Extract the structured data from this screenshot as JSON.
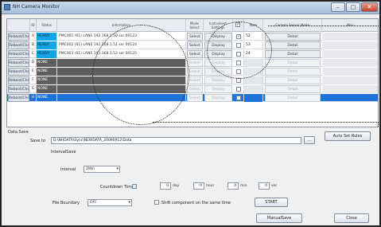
{
  "window": {
    "title": "NH Camera Monitor",
    "controls": {
      "minimize": "–",
      "maximize": "□",
      "close": "✕"
    }
  },
  "grid": {
    "columns": [
      {
        "key": "reset",
        "label": ""
      },
      {
        "key": "id",
        "label": "ID"
      },
      {
        "key": "status",
        "label": "Status"
      },
      {
        "key": "info",
        "label": "Information"
      },
      {
        "key": "mode",
        "label": "Mode\nSelect"
      },
      {
        "key": "params",
        "label": "Instrument\nSettings"
      },
      {
        "key": "check",
        "label": ""
      },
      {
        "key": "num",
        "label": "Num"
      },
      {
        "key": "sub",
        "label": "Camera Sensor Mode"
      },
      {
        "key": "misc",
        "label": "Misc"
      }
    ],
    "rows": [
      {
        "reset": "Reboot/Check",
        "id": "A",
        "status": "READY",
        "info": "PMC001 (01) LANE 192.168.1.50 ser 00123",
        "select": "Select",
        "display": "Display",
        "checked": true,
        "num": "52",
        "detail": "Detail",
        "enabled": true,
        "selected": false
      },
      {
        "reset": "Reboot/Check",
        "id": "B",
        "status": "READY",
        "info": "PMC002 (01) LANE 192.168.1.51 ser 00124",
        "select": "Select",
        "display": "Display",
        "checked": false,
        "num": "53",
        "detail": "Detail",
        "enabled": true,
        "selected": false
      },
      {
        "reset": "Reboot/Check",
        "id": "C",
        "status": "READY",
        "info": "PMC003 (01) LANE 192.168.1.52 ser 00125",
        "select": "Select",
        "display": "Display",
        "checked": false,
        "num": "24",
        "detail": "Detail",
        "enabled": true,
        "selected": false
      },
      {
        "reset": "Reboot/Check",
        "id": "D",
        "status": "NONE",
        "info": "",
        "select": "Select",
        "display": "Display",
        "checked": false,
        "num": "",
        "detail": "Detail",
        "enabled": false,
        "selected": false
      },
      {
        "reset": "Reboot/Check",
        "id": "E",
        "status": "NONE",
        "info": "",
        "select": "Select",
        "display": "Display",
        "checked": false,
        "num": "",
        "detail": "Detail",
        "enabled": false,
        "selected": false
      },
      {
        "reset": "Reboot/Check",
        "id": "F",
        "status": "NONE",
        "info": "",
        "select": "Select",
        "display": "Display",
        "checked": false,
        "num": "",
        "detail": "Detail",
        "enabled": false,
        "selected": false
      },
      {
        "reset": "Reboot/Check",
        "id": "G",
        "status": "NONE",
        "info": "",
        "select": "Select",
        "display": "Display",
        "checked": false,
        "num": "",
        "detail": "Detail",
        "enabled": false,
        "selected": false
      },
      {
        "reset": "Reboot/Check",
        "id": "H",
        "status": "NONE",
        "info": "",
        "select": "Select",
        "display": "Display",
        "checked": false,
        "num": "",
        "detail": "Detail",
        "enabled": false,
        "selected": true
      }
    ]
  },
  "data_save": {
    "section_label": "Data Save",
    "save_to_label": "Save to",
    "save_to_value": "D:\\NHDATA\\Sync\\NEWDATA_20090912\\Data",
    "browse_label": "...",
    "auto_set_label": "Auto Set Rules",
    "interval_save_label": "IntervalSave",
    "interval_label": "Interval",
    "interval_value": "1Min",
    "countdown_label": "Countdown Timer",
    "days_value": "0",
    "days_unit": "day",
    "hours_value": "0",
    "hours_unit": "hour",
    "mins_value": "0",
    "mins_unit": "min",
    "secs_value": "0",
    "secs_unit": "sec",
    "file_boundary_label": "File Boundary",
    "file_boundary_value": "OFF",
    "shift_label": "Shift component on the same time",
    "start_label": "START",
    "manual_save_label": "ManualSave",
    "close_label": "Close"
  },
  "icons": {
    "app": "camera-app-icon",
    "dropdown": "chevron-down-icon",
    "check": "✓"
  },
  "colors": {
    "ready": "#14a4e6",
    "selected_row": "#1e73d9",
    "empty_row": "#5e5e5e"
  }
}
